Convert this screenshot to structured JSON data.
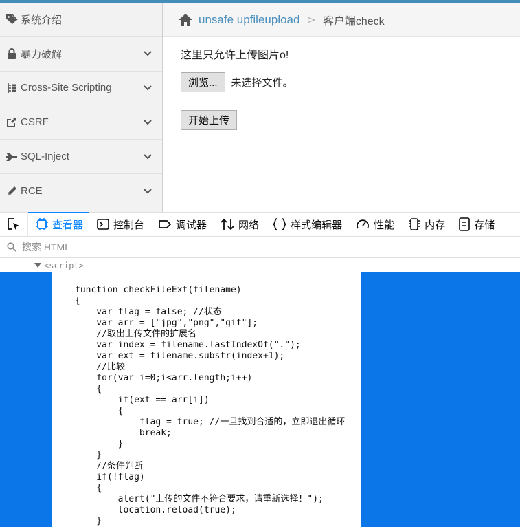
{
  "sidebar": {
    "items": [
      {
        "label": "系统介绍",
        "icon": "tags-icon",
        "chevron": false
      },
      {
        "label": "暴力破解",
        "icon": "lock-icon",
        "chevron": true
      },
      {
        "label": "Cross-Site Scripting",
        "icon": "sitemap-icon",
        "chevron": true
      },
      {
        "label": "CSRF",
        "icon": "share-square-icon",
        "chevron": true
      },
      {
        "label": "SQL-Inject",
        "icon": "plane-icon",
        "chevron": true
      },
      {
        "label": "RCE",
        "icon": "pencil-icon",
        "chevron": true
      }
    ]
  },
  "breadcrumb": {
    "home_icon": "home-icon",
    "link": "unsafe upfileupload",
    "separator": ">",
    "current": "客户端check"
  },
  "content": {
    "notice": "这里只允许上传图片o!",
    "browse_label": "浏览...",
    "no_file": "未选择文件。",
    "upload_label": "开始上传"
  },
  "devtools": {
    "tabs": [
      {
        "label": "查看器",
        "icon": "inspector-icon",
        "active": true
      },
      {
        "label": "控制台",
        "icon": "console-icon",
        "active": false
      },
      {
        "label": "调试器",
        "icon": "debugger-icon",
        "active": false
      },
      {
        "label": "网络",
        "icon": "network-icon",
        "active": false
      },
      {
        "label": "样式编辑器",
        "icon": "style-editor-icon",
        "active": false
      },
      {
        "label": "性能",
        "icon": "performance-icon",
        "active": false
      },
      {
        "label": "内存",
        "icon": "memory-icon",
        "active": false
      },
      {
        "label": "存储",
        "icon": "storage-icon",
        "active": false
      }
    ],
    "search_placeholder": "搜索 HTML",
    "node": "<script>",
    "accent_color": "#0a84ff",
    "highlight_color": "#0a76e8",
    "code": "function checkFileExt(filename)\n{\n    var flag = false; //状态\n    var arr = [\"jpg\",\"png\",\"gif\"];\n    //取出上传文件的扩展名\n    var index = filename.lastIndexOf(\".\");\n    var ext = filename.substr(index+1);\n    //比较\n    for(var i=0;i<arr.length;i++)\n    {\n        if(ext == arr[i])\n        {\n            flag = true; //一旦找到合适的，立即退出循环\n            break;\n        }\n    }\n    //条件判断\n    if(!flag)\n    {\n        alert(\"上传的文件不符合要求，请重新选择！\");\n        location.reload(true);\n    }"
  }
}
